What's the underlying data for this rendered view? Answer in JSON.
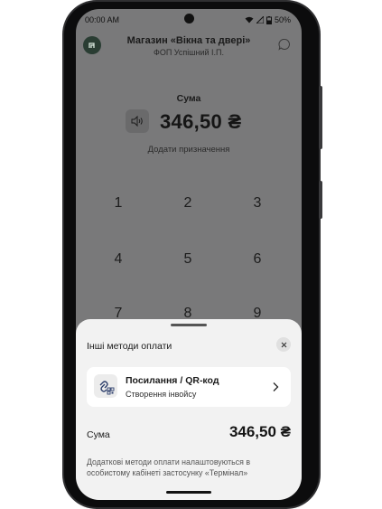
{
  "status": {
    "time": "00:00 AM",
    "battery": "50%"
  },
  "header": {
    "title": "Магазин «Вікна та двері»",
    "subtitle": "ФОП Успішний І.П."
  },
  "payment": {
    "sum_label": "Сума",
    "amount": "346,50 ₴",
    "add_purpose": "Додати призначення"
  },
  "keypad": [
    "1",
    "2",
    "3",
    "4",
    "5",
    "6",
    "7",
    "8",
    "9"
  ],
  "sheet": {
    "title": "Інші методи оплати",
    "method": {
      "title": "Посилання / QR-код",
      "subtitle": "Створення інвойсу"
    },
    "sum_label": "Сума",
    "sum_value": "346,50 ₴",
    "note": "Додаткові методи оплати налаштовуються в особистому кабінеті застосунку «Термінал»"
  },
  "colors": {
    "overlay": "#79797a",
    "sheet": "#f2f2f2",
    "logo": "#2a3d33"
  },
  "icons": [
    "wifi-icon",
    "signal-icon",
    "battery-icon",
    "chat-icon",
    "speaker-icon",
    "close-icon",
    "link-qr-icon",
    "chevron-right-icon"
  ]
}
